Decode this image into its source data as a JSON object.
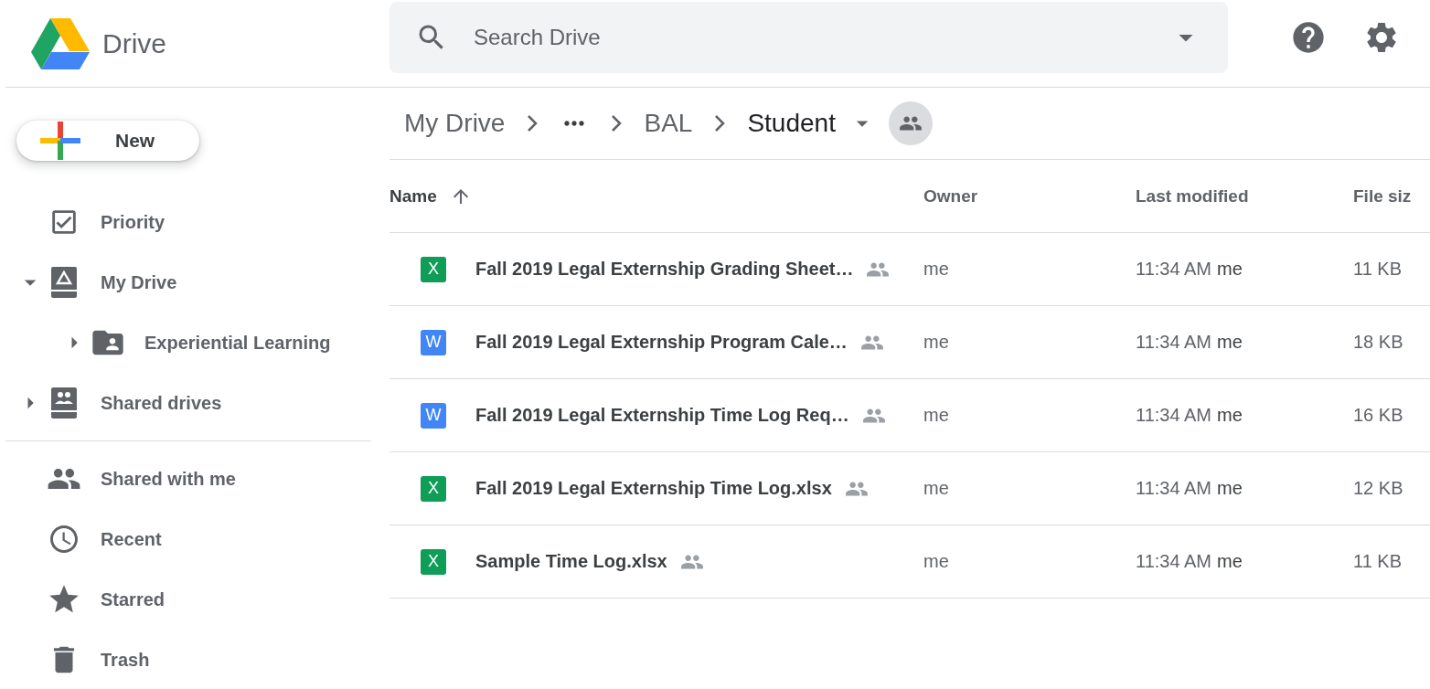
{
  "header": {
    "product": "Drive",
    "search": {
      "placeholder": "Search Drive"
    }
  },
  "new_button": {
    "label": "New"
  },
  "sidebar": {
    "sections": [
      [
        {
          "label": "Priority",
          "kind": "priority"
        },
        {
          "label": "My Drive",
          "kind": "drive",
          "expanded": true,
          "children": [
            {
              "label": "Experiential Learning",
              "kind": "shared-folder",
              "expanded": false
            }
          ]
        },
        {
          "label": "Shared drives",
          "kind": "shared-drive",
          "expanded": false
        }
      ],
      [
        {
          "label": "Shared with me",
          "kind": "people"
        },
        {
          "label": "Recent",
          "kind": "clock"
        },
        {
          "label": "Starred",
          "kind": "star"
        },
        {
          "label": "Trash",
          "kind": "trash"
        }
      ]
    ]
  },
  "breadcrumb": [
    {
      "kind": "text",
      "label": "My Drive"
    },
    {
      "kind": "more"
    },
    {
      "kind": "text",
      "label": "BAL"
    },
    {
      "kind": "current",
      "label": "Student"
    }
  ],
  "table": {
    "columns": [
      {
        "label": "Name",
        "sorted": true
      },
      {
        "label": "Owner",
        "sorted": false
      },
      {
        "label": "Last modified",
        "sorted": false
      },
      {
        "label": "File siz",
        "sorted": false
      }
    ],
    "rows": [
      {
        "kind": "sheet",
        "badge": "X",
        "name": "Fall 2019 Legal Externship Grading Sheet…",
        "owner": "me",
        "modified": "11:34 AM",
        "modified_by": "me",
        "size": "11 KB"
      },
      {
        "kind": "doc",
        "badge": "W",
        "name": "Fall 2019 Legal Externship Program Cale…",
        "owner": "me",
        "modified": "11:34 AM",
        "modified_by": "me",
        "size": "18 KB"
      },
      {
        "kind": "doc",
        "badge": "W",
        "name": "Fall 2019 Legal Externship Time Log Req…",
        "owner": "me",
        "modified": "11:34 AM",
        "modified_by": "me",
        "size": "16 KB"
      },
      {
        "kind": "sheet",
        "badge": "X",
        "name": "Fall 2019 Legal Externship Time Log.xlsx",
        "owner": "me",
        "modified": "11:34 AM",
        "modified_by": "me",
        "size": "12 KB"
      },
      {
        "kind": "sheet",
        "badge": "X",
        "name": "Sample Time Log.xlsx",
        "owner": "me",
        "modified": "11:34 AM",
        "modified_by": "me",
        "size": "11 KB"
      }
    ]
  }
}
